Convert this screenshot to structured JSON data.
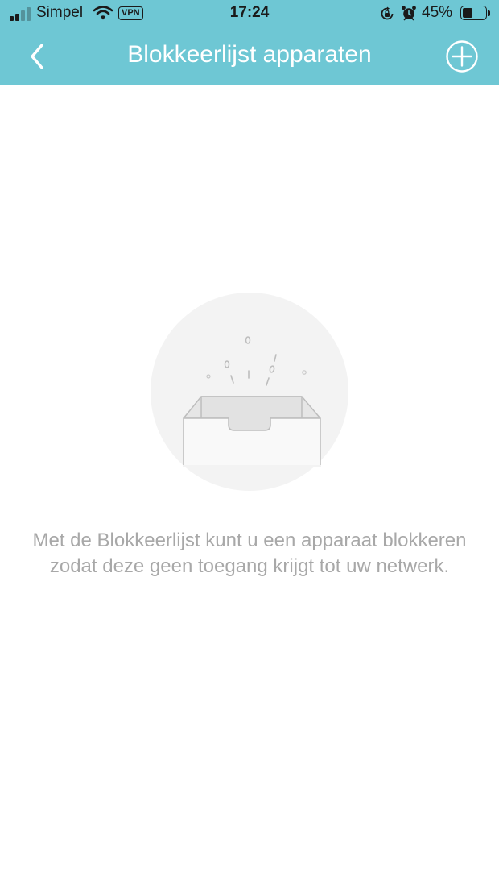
{
  "status_bar": {
    "carrier": "Simpel",
    "vpn": "VPN",
    "time": "17:24",
    "battery_percent": "45%",
    "battery_level": 0.45,
    "icons": [
      "signal-icon",
      "wifi-icon",
      "vpn-badge",
      "rotation-lock-icon",
      "alarm-icon",
      "battery-icon"
    ]
  },
  "header": {
    "title": "Blokkeerlijst apparaten",
    "back_icon": "chevron-left-icon",
    "add_icon": "plus-circle-icon",
    "background": "#6ec7d4"
  },
  "empty_state": {
    "illustration": "empty-box-icon",
    "message": "Met de Blokkeerlijst kunt u een apparaat blokkeren zodat deze geen toegang krijgt tot uw netwerk.",
    "text_color": "#a8a8a8"
  }
}
